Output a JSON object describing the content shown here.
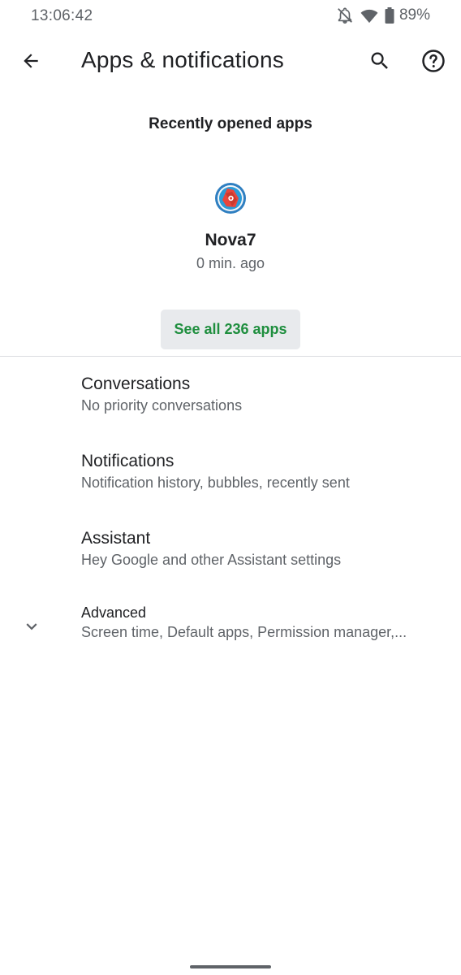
{
  "status_bar": {
    "time": "13:06:42",
    "battery": "89%",
    "icons": [
      "notifications-off-icon",
      "wifi-icon",
      "battery-icon"
    ]
  },
  "app_bar": {
    "title": "Apps & notifications",
    "icons": [
      "back-arrow-icon",
      "search-icon",
      "help-icon"
    ]
  },
  "recent": {
    "header": "Recently opened apps",
    "apps": [
      {
        "name": "Nova7",
        "time": "0 min. ago",
        "icon": "nova7-app-icon"
      }
    ],
    "see_all_label": "See all 236 apps"
  },
  "preferences": [
    {
      "title": "Conversations",
      "summary": "No priority conversations"
    },
    {
      "title": "Notifications",
      "summary": "Notification history, bubbles, recently sent"
    },
    {
      "title": "Assistant",
      "summary": "Hey Google and other Assistant settings"
    },
    {
      "title": "Advanced",
      "summary": "Screen time, Default apps, Permission manager,...",
      "icon": "chevron-down-icon"
    }
  ],
  "colors": {
    "accent_green": "#1e8e3e",
    "button_bg": "#e8eaed",
    "primary_text": "#202124",
    "secondary_text": "#5f6368"
  }
}
